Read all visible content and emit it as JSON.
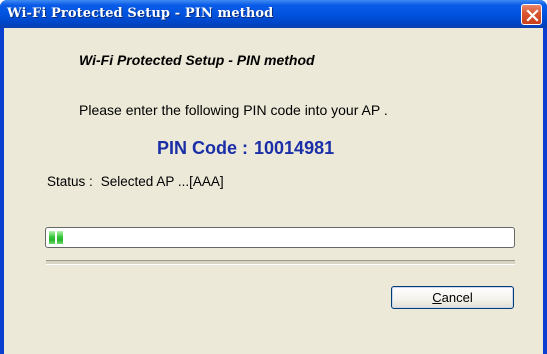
{
  "window": {
    "title": "Wi-Fi Protected Setup - PIN method",
    "close_icon": "close-icon"
  },
  "dialog": {
    "heading": "Wi-Fi Protected Setup - PIN method",
    "instruction": "Please enter the following PIN code into your AP .",
    "pin_label": "PIN Code :",
    "pin_value": "10014981",
    "status_label": "Status :",
    "status_value": "Selected AP ...[AAA]",
    "progress_fraction": 0.03
  },
  "buttons": {
    "cancel_first_letter": "C",
    "cancel_rest": "ancel"
  },
  "colors": {
    "titlebar": "#0053e0",
    "pin_text": "#1a2ea8",
    "progress_green": "#36c83a",
    "close_button": "#d9552f",
    "dialog_background": "#ece9d8"
  }
}
